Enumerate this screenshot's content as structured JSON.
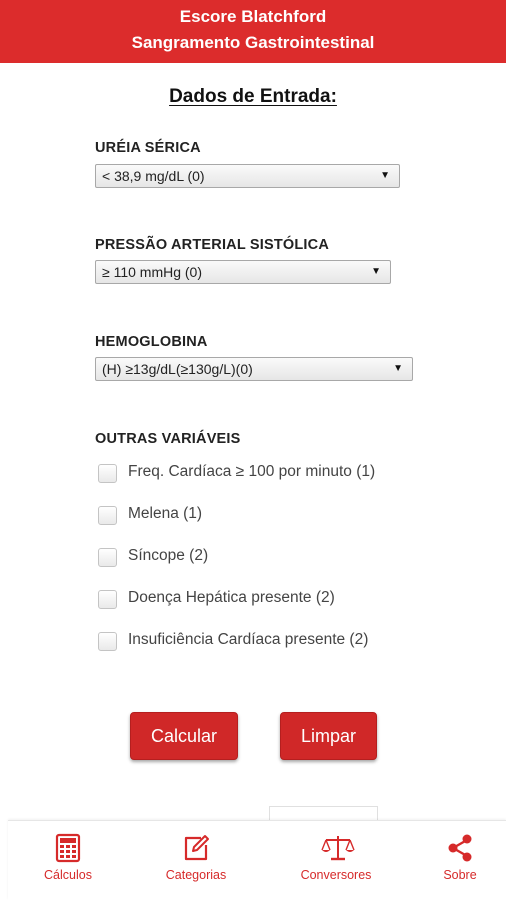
{
  "header": {
    "title_line1": "Escore Blatchford",
    "title_line2": "Sangramento Gastrointestinal"
  },
  "form": {
    "section_title": "Dados de Entrada:",
    "ureia": {
      "label": "URÉIA SÉRICA",
      "selected": "< 38,9 mg/dL (0)"
    },
    "pressao": {
      "label": "PRESSÃO ARTERIAL SISTÓLICA",
      "selected": "≥ 110 mmHg (0)"
    },
    "hemoglobina": {
      "label": "HEMOGLOBINA",
      "selected": "(H) ≥13g/dL(≥130g/L)(0)"
    },
    "outras": {
      "label": "OUTRAS VARIÁVEIS",
      "items": [
        {
          "label": "Freq. Cardíaca ≥ 100 por minuto (1)",
          "checked": false
        },
        {
          "label": "Melena (1)",
          "checked": false
        },
        {
          "label": "Síncope (2)",
          "checked": false
        },
        {
          "label": "Doença Hepática presente (2)",
          "checked": false
        },
        {
          "label": "Insuficiência Cardíaca presente (2)",
          "checked": false
        }
      ]
    },
    "buttons": {
      "calcular": "Calcular",
      "limpar": "Limpar"
    }
  },
  "tabbar": {
    "tabs": [
      {
        "label": "Cálculos",
        "icon": "calculator-icon"
      },
      {
        "label": "Categorias",
        "icon": "edit-icon"
      },
      {
        "label": "Conversores",
        "icon": "scale-icon"
      },
      {
        "label": "Sobre",
        "icon": "share-icon"
      }
    ]
  },
  "colors": {
    "accent": "#dc2c2c",
    "button": "#d02828",
    "tab": "#d62a2a"
  }
}
